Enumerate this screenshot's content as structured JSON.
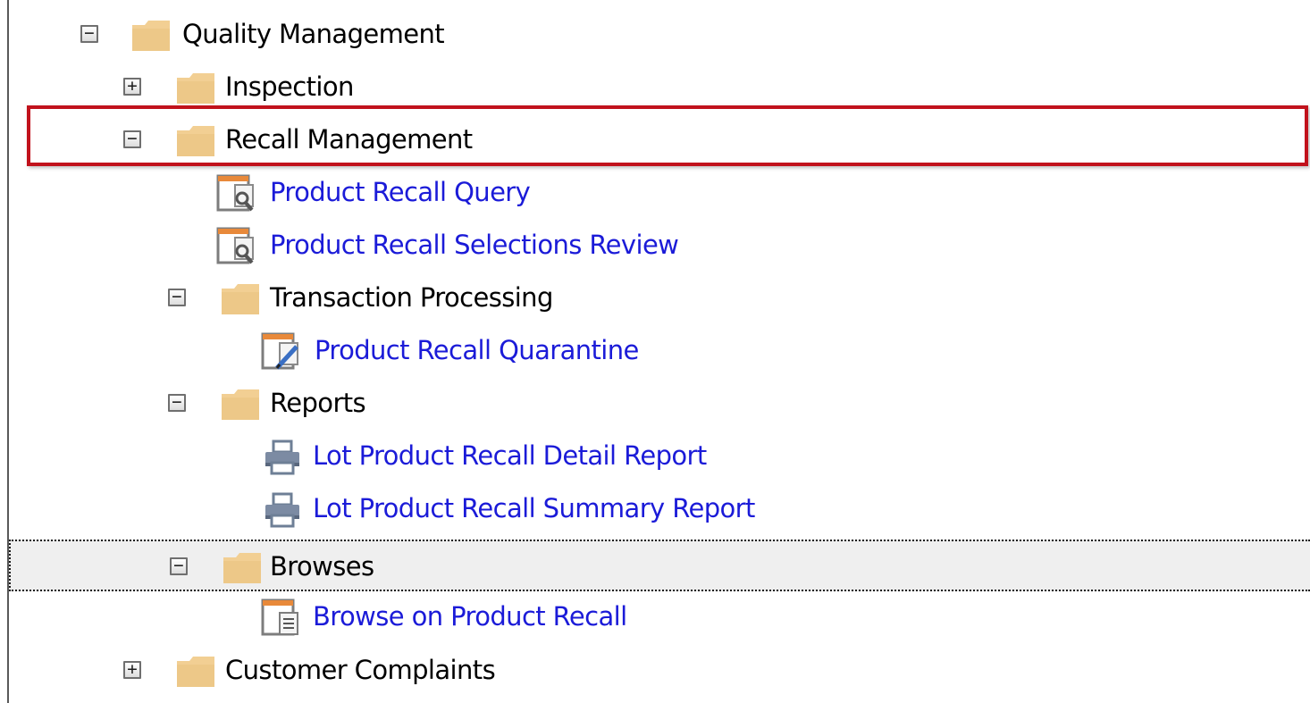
{
  "tree": {
    "nodes": [
      {
        "id": "quality-management",
        "label": "Quality Management",
        "kind": "folder",
        "expanded": true
      },
      {
        "id": "inspection",
        "label": "Inspection",
        "kind": "folder",
        "expanded": false
      },
      {
        "id": "recall-management",
        "label": "Recall Management",
        "kind": "folder",
        "expanded": true
      },
      {
        "id": "product-recall-query",
        "label": "Product Recall Query",
        "kind": "query-program"
      },
      {
        "id": "product-recall-selections-review",
        "label": "Product Recall Selections Review",
        "kind": "query-program"
      },
      {
        "id": "transaction-processing",
        "label": "Transaction Processing",
        "kind": "folder",
        "expanded": true
      },
      {
        "id": "product-recall-quarantine",
        "label": "Product Recall Quarantine",
        "kind": "edit-program"
      },
      {
        "id": "reports",
        "label": "Reports",
        "kind": "folder",
        "expanded": true
      },
      {
        "id": "lot-product-recall-detail-report",
        "label": "Lot Product Recall Detail Report",
        "kind": "report"
      },
      {
        "id": "lot-product-recall-summary-report",
        "label": "Lot Product Recall Summary Report",
        "kind": "report"
      },
      {
        "id": "browses",
        "label": "Browses",
        "kind": "folder",
        "expanded": true,
        "focused": true
      },
      {
        "id": "browse-on-product-recall",
        "label": "Browse on Product Recall",
        "kind": "browse-program"
      },
      {
        "id": "customer-complaints",
        "label": "Customer Complaints",
        "kind": "folder",
        "expanded": false
      }
    ],
    "toggle_symbols": {
      "expanded": "−",
      "collapsed": "+"
    }
  },
  "highlight": {
    "target": "recall-management",
    "color": "#c1121c"
  },
  "colors": {
    "folder": "#f2cf93",
    "link_text": "#1b1bd8",
    "folder_text": "#000000",
    "focus_background": "#efefef"
  },
  "icons": {
    "folder": "folder-icon",
    "query_program": "document-search-icon",
    "edit_program": "document-edit-icon",
    "report": "printer-icon",
    "browse_program": "document-list-icon",
    "expand": "expand-plus-icon",
    "collapse": "collapse-minus-icon"
  }
}
